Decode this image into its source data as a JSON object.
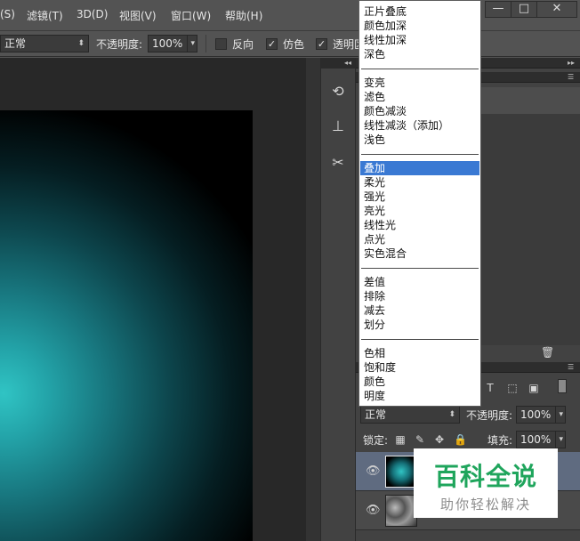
{
  "menubar": {
    "items": [
      "(S)",
      "滤镜(T)",
      "3D(D)",
      "视图(V)",
      "窗口(W)",
      "帮助(H)"
    ],
    "window_buttons": [
      "—",
      "□",
      "✕"
    ]
  },
  "options_bar": {
    "mode_value": "正常",
    "opacity_label": "不透明度:",
    "opacity_value": "100%",
    "reverse_label": "反向",
    "dither_label": "仿色",
    "transparency_label": "透明区"
  },
  "blend_modes": {
    "groups": [
      [
        "正片叠底",
        "颜色加深",
        "线性加深",
        "深色"
      ],
      [
        "变亮",
        "滤色",
        "颜色减淡",
        "线性减淡（添加）",
        "浅色"
      ],
      [
        "叠加",
        "柔光",
        "强光",
        "亮光",
        "线性光",
        "点光",
        "实色混合"
      ],
      [
        "差值",
        "排除",
        "减去",
        "划分"
      ],
      [
        "色相",
        "饱和度",
        "颜色",
        "明度"
      ]
    ],
    "selected": "叠加"
  },
  "layers_panel": {
    "blend_value": "正常",
    "opacity_label": "不透明度:",
    "opacity_value": "100%",
    "lock_label": "锁定:",
    "fill_label": "填充:",
    "fill_value": "100%"
  },
  "watermark": {
    "title": "百科全说",
    "subtitle": "助你轻松解决"
  },
  "colors": {
    "accent_selection": "#3a79d3",
    "glow": "#30c4c4",
    "watermark_green": "#1fa55c"
  }
}
